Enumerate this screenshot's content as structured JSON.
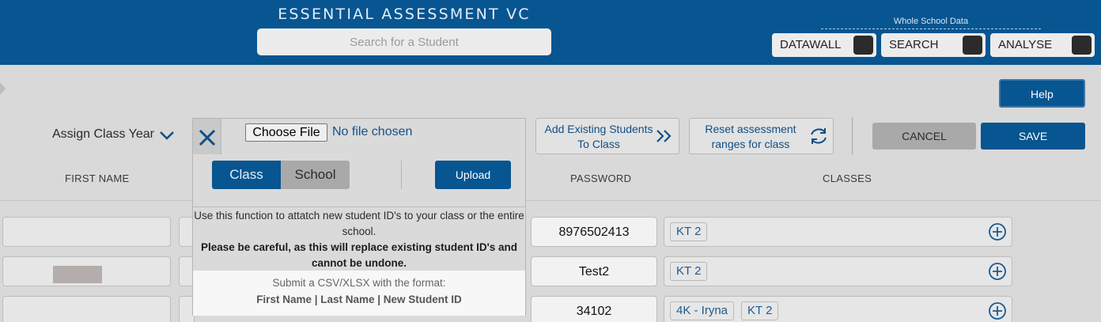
{
  "header": {
    "app_title": "ESSENTIAL ASSESSMENT VC",
    "search_placeholder": "Search for a Student",
    "whole_school_label": "Whole School Data",
    "toggles": [
      {
        "label": "DATAWALL",
        "on": false
      },
      {
        "label": "SEARCH",
        "on": false
      },
      {
        "label": "ANALYSE",
        "on": false
      }
    ]
  },
  "toolbar": {
    "help_label": "Help",
    "assign_class_year_label": "Assign Class Year",
    "add_existing_label": "Add Existing Students To Class",
    "reset_label": "Reset assessment ranges for class",
    "cancel_label": "CANCEL",
    "save_label": "SAVE"
  },
  "table": {
    "columns": {
      "first_name": "FIRST NAME",
      "password": "PASSWORD",
      "classes": "CLASSES"
    },
    "rows": [
      {
        "password": "8976502413",
        "classes": [
          "KT 2"
        ]
      },
      {
        "password": "Test2",
        "classes": [
          "KT 2"
        ]
      },
      {
        "password": "34102",
        "classes": [
          "4K - Iryna",
          "KT 2"
        ]
      }
    ]
  },
  "modal": {
    "choose_file_label": "Choose File",
    "no_file_label": "No file chosen",
    "scope_options": [
      "Class",
      "School"
    ],
    "selected_scope": "Class",
    "upload_label": "Upload",
    "description": "Use this function to attatch new student ID's to your class or the entire school.",
    "warning": "Please be careful, as this will replace existing student ID's and cannot be undone.",
    "format_intro": "Submit a CSV/XLSX with the format:",
    "format_spec": "First Name | Last Name | New Student ID"
  },
  "colors": {
    "brand_blue": "#075591",
    "dimmed_background": "#d9d9d9",
    "link_blue": "#0f4f86"
  }
}
